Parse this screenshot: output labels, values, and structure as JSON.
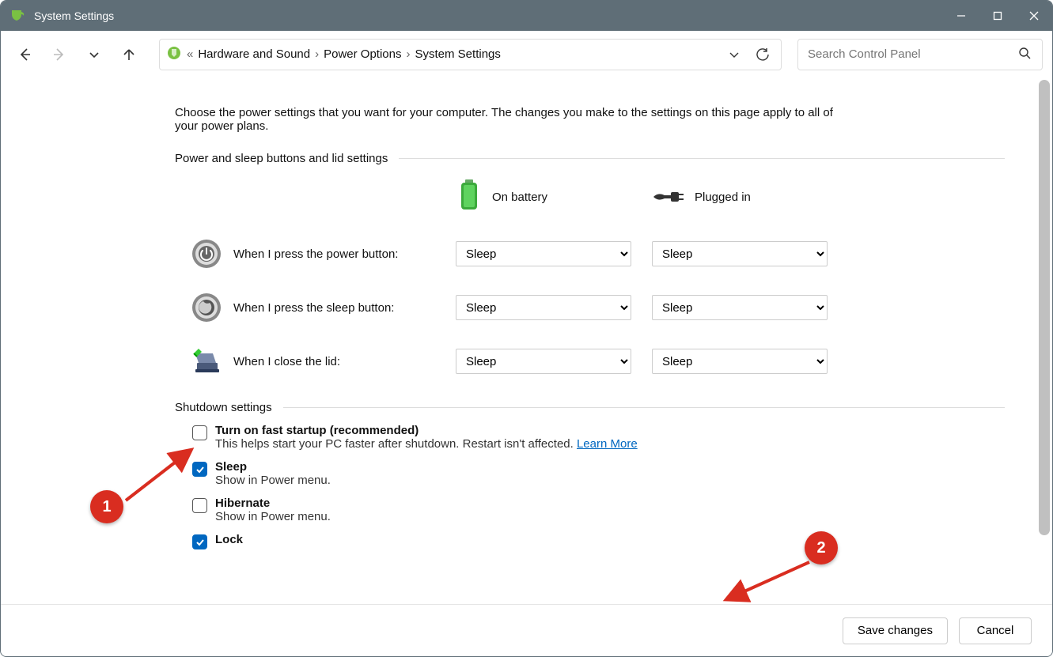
{
  "window": {
    "title": "System Settings"
  },
  "breadcrumb": {
    "level1": "Hardware and Sound",
    "level2": "Power Options",
    "level3": "System Settings"
  },
  "search": {
    "placeholder": "Search Control Panel"
  },
  "intro": "Choose the power settings that you want for your computer. The changes you make to the settings on this page apply to all of your power plans.",
  "section1": {
    "title": "Power and sleep buttons and lid settings"
  },
  "columns": {
    "battery": "On battery",
    "plugged": "Plugged in"
  },
  "rows": {
    "power": {
      "label": "When I press the power button:",
      "battery": "Sleep",
      "plugged": "Sleep"
    },
    "sleep": {
      "label": "When I press the sleep button:",
      "battery": "Sleep",
      "plugged": "Sleep"
    },
    "lid": {
      "label": "When I close the lid:",
      "battery": "Sleep",
      "plugged": "Sleep"
    }
  },
  "section2": {
    "title": "Shutdown settings"
  },
  "shutdown": {
    "fast": {
      "label": "Turn on fast startup (recommended)",
      "desc": "This helps start your PC faster after shutdown. Restart isn't affected. ",
      "learn": "Learn More",
      "checked": false
    },
    "sleep": {
      "label": "Sleep",
      "desc": "Show in Power menu.",
      "checked": true
    },
    "hibernate": {
      "label": "Hibernate",
      "desc": "Show in Power menu.",
      "checked": false
    },
    "lock": {
      "label": "Lock",
      "checked": true
    }
  },
  "footer": {
    "save": "Save changes",
    "cancel": "Cancel"
  },
  "annotations": {
    "one": "1",
    "two": "2"
  }
}
